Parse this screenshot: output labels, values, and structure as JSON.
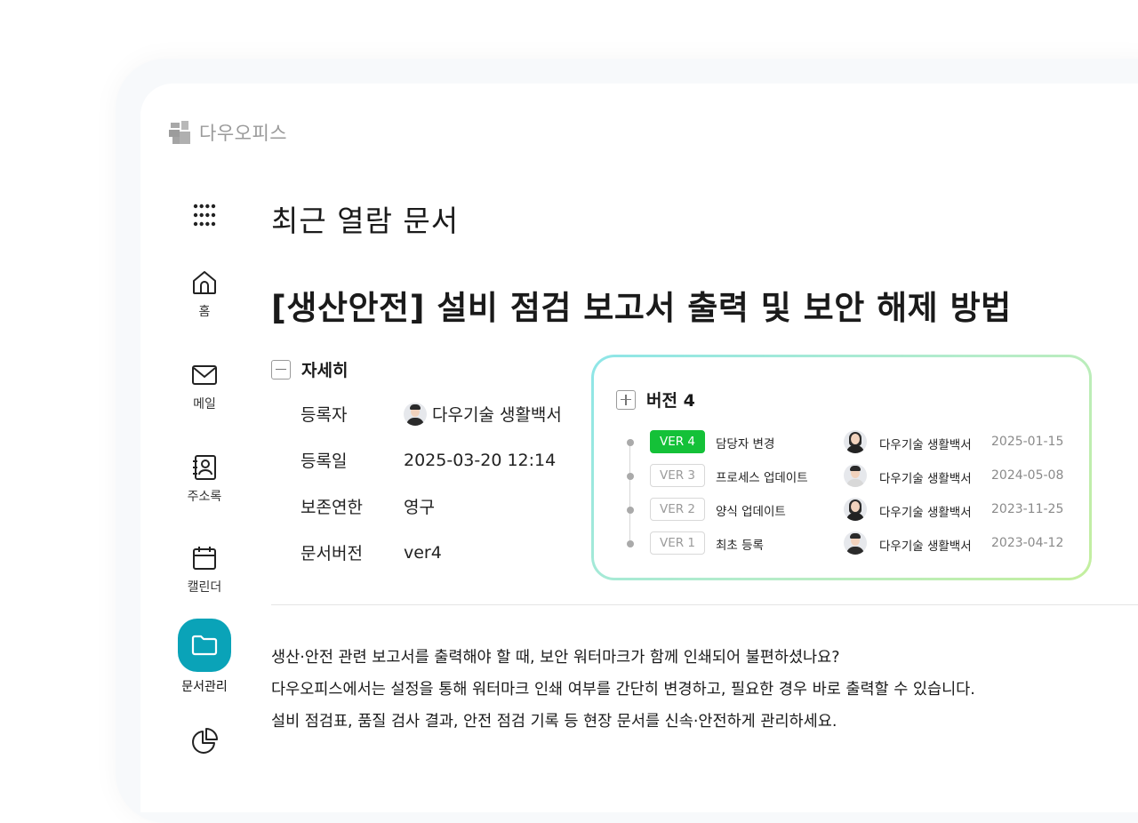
{
  "app": {
    "name": "다우오피스"
  },
  "nav": {
    "items": [
      {
        "label": "홈",
        "icon": "home-icon"
      },
      {
        "label": "메일",
        "icon": "mail-icon"
      },
      {
        "label": "주소록",
        "icon": "contacts-icon"
      },
      {
        "label": "캘린더",
        "icon": "calendar-icon"
      },
      {
        "label": "문서관리",
        "icon": "folder-icon",
        "active": true
      },
      {
        "label": "",
        "icon": "pie-chart-icon"
      }
    ],
    "active_color": "#0aa3b8"
  },
  "page": {
    "title": "최근 열람 문서",
    "doc_title": "[생산안전] 설비 점검 보고서 출력 및 보안 해제 방법"
  },
  "details": {
    "toggle_label": "자세히",
    "rows": [
      {
        "key": "등록자",
        "value": "다우기술 생활백서"
      },
      {
        "key": "등록일",
        "value": "2025-03-20 12:14"
      },
      {
        "key": "보존연한",
        "value": "영구"
      },
      {
        "key": "문서버전",
        "value": "ver4"
      }
    ]
  },
  "versions": {
    "title": "버전 4",
    "items": [
      {
        "tag": "VER 4",
        "desc": "담당자 변경",
        "author": "다우기술 생활백서",
        "date": "2025-01-15",
        "active": true
      },
      {
        "tag": "VER 3",
        "desc": "프로세스 업데이트",
        "author": "다우기술 생활백서",
        "date": "2024-05-08",
        "active": false
      },
      {
        "tag": "VER 2",
        "desc": "양식 업데이트",
        "author": "다우기술 생활백서",
        "date": "2023-11-25",
        "active": false
      },
      {
        "tag": "VER 1",
        "desc": "최초 등록",
        "author": "다우기술 생활백서",
        "date": "2023-04-12",
        "active": false
      }
    ],
    "active_color": "#14c138"
  },
  "description": [
    "생산·안전 관련 보고서를 출력해야 할 때, 보안 워터마크가 함께 인쇄되어 불편하셨나요?",
    "다우오피스에서는 설정을 통해 워터마크 인쇄 여부를 간단히 변경하고, 필요한 경우 바로 출력할 수 있습니다.",
    "설비 점검표, 품질 검사 결과, 안전 점검 기록 등 현장 문서를 신속·안전하게 관리하세요."
  ]
}
